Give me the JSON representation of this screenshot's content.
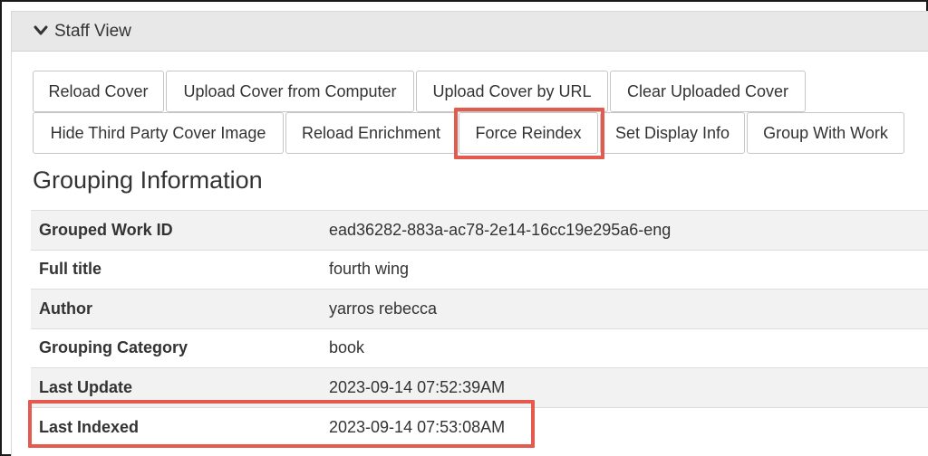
{
  "panel": {
    "title": "Staff View"
  },
  "buttons": [
    "Reload Cover",
    "Upload Cover from Computer",
    "Upload Cover by URL",
    "Clear Uploaded Cover",
    "Hide Third Party Cover Image",
    "Reload Enrichment",
    "Force Reindex",
    "Set Display Info",
    "Group With Work"
  ],
  "grouping": {
    "heading": "Grouping Information",
    "rows": [
      {
        "key": "Grouped Work ID",
        "value": "ead36282-883a-ac78-2e14-16cc19e295a6-eng"
      },
      {
        "key": "Full title",
        "value": "fourth wing"
      },
      {
        "key": "Author",
        "value": "yarros rebecca"
      },
      {
        "key": "Grouping Category",
        "value": "book"
      },
      {
        "key": "Last Update",
        "value": "2023-09-14 07:52:39AM"
      },
      {
        "key": "Last Indexed",
        "value": "2023-09-14 07:53:08AM"
      }
    ]
  },
  "colors": {
    "highlight": "#e45a4f",
    "header_bg": "#e8e8e8",
    "stripe": "#f2f2f2"
  },
  "icons": {
    "panel_toggle": "chevron-down-icon"
  }
}
